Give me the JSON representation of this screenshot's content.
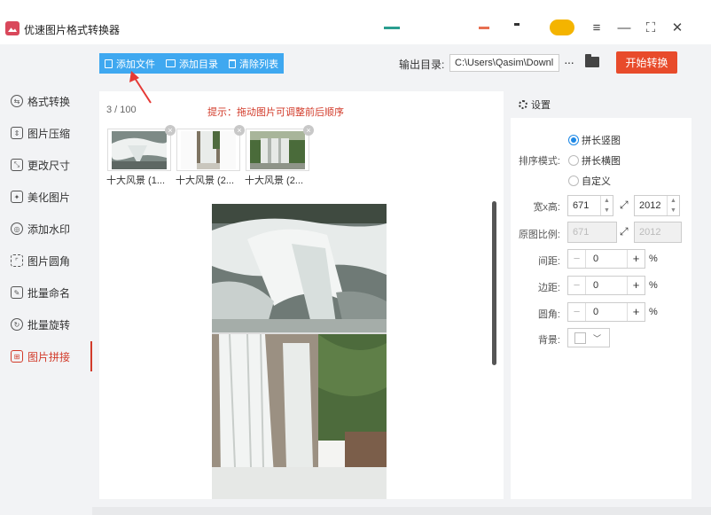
{
  "window": {
    "title": "优速图片格式转换器",
    "controls": [
      "≡",
      "—",
      "⛶",
      "✕"
    ]
  },
  "sidebar": {
    "items": [
      {
        "label": "格式转换",
        "icon": "convert-icon",
        "glyph": "⇆"
      },
      {
        "label": "图片压缩",
        "icon": "compress-icon",
        "glyph": "⇕"
      },
      {
        "label": "更改尺寸",
        "icon": "resize-icon",
        "glyph": "⤡"
      },
      {
        "label": "美化图片",
        "icon": "beautify-icon",
        "glyph": "✦"
      },
      {
        "label": "添加水印",
        "icon": "watermark-icon",
        "glyph": "◎"
      },
      {
        "label": "图片圆角",
        "icon": "round-corner-icon",
        "glyph": "⌜"
      },
      {
        "label": "批量命名",
        "icon": "rename-icon",
        "glyph": "✎"
      },
      {
        "label": "批量旋转",
        "icon": "rotate-icon",
        "glyph": "↻"
      },
      {
        "label": "图片拼接",
        "icon": "stitch-icon",
        "glyph": "⊞",
        "active": true
      }
    ]
  },
  "toolbar": {
    "add_file": "添加文件",
    "add_dir": "添加目录",
    "clear_list": "清除列表",
    "output_label": "输出目录:",
    "output_path": "C:\\Users\\Qasim\\Downl",
    "more": "···",
    "start": "开始转换"
  },
  "main": {
    "count": "3 / 100",
    "hint": "提示：拖动图片可调整前后顺序",
    "thumbnails": [
      {
        "caption": "十大风景 (1..."
      },
      {
        "caption": "十大风景 (2..."
      },
      {
        "caption": "十大风景 (2..."
      }
    ],
    "remove_glyph": "×"
  },
  "settings": {
    "title": "设置",
    "sort_label": "排序模式:",
    "sort_options": [
      "拼长竖图",
      "拼长横图",
      "自定义"
    ],
    "sort_selected": 0,
    "size_label": "宽x高:",
    "width": "671",
    "height": "2012",
    "ratio_label": "原图比例:",
    "ratio_w": "671",
    "ratio_h": "2012",
    "link_glyph": "⤢",
    "spacing_label": "间距:",
    "spacing": "0",
    "margin_label": "边距:",
    "margin": "0",
    "radius_label": "圆角:",
    "radius": "0",
    "unit": "%",
    "bg_label": "背景:",
    "bg_color": "#ffffff",
    "minus": "−",
    "plus": "+"
  }
}
